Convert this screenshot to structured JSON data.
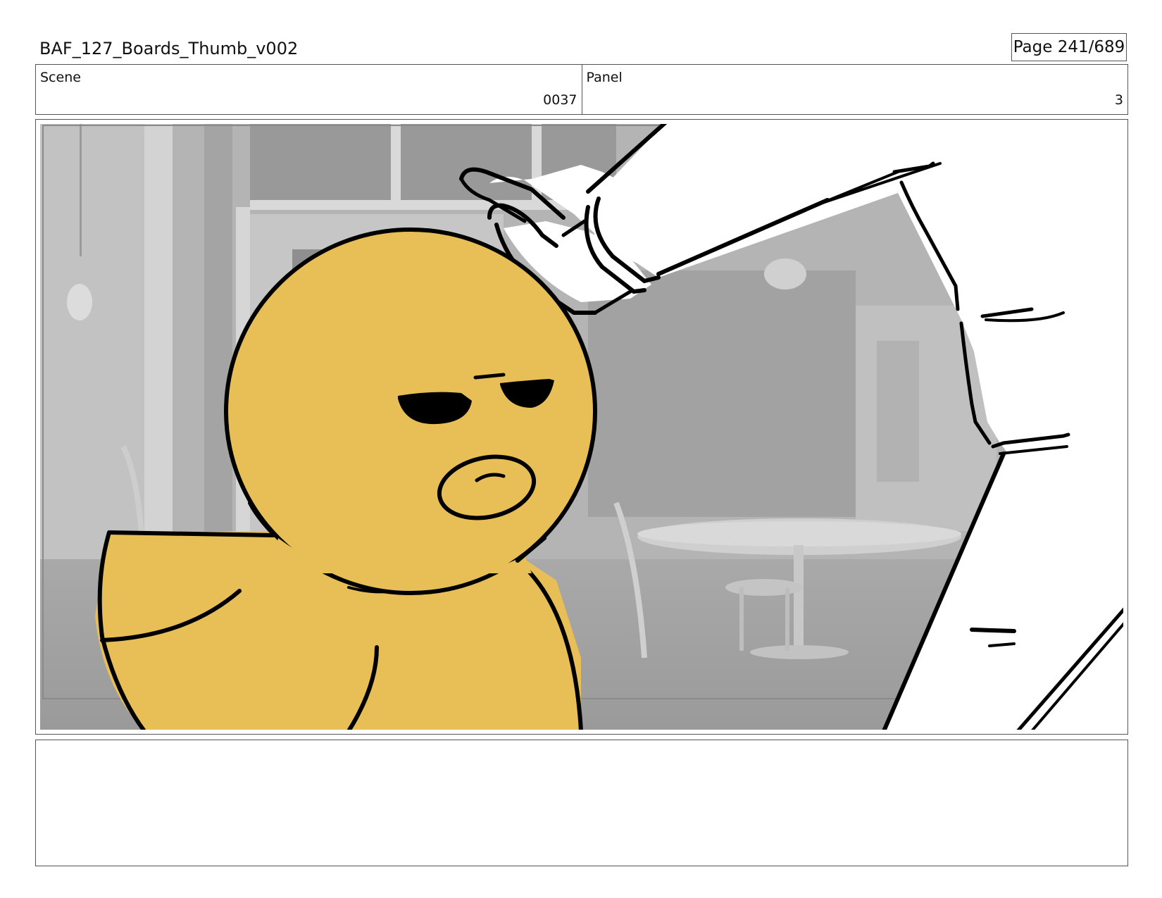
{
  "header": {
    "title": "BAF_127_Boards_Thumb_v002",
    "page_indicator": "Page 241/689"
  },
  "info": {
    "scene_label": "Scene",
    "scene_value": "0037",
    "panel_label": "Panel",
    "panel_value": "3"
  },
  "panel": {
    "colors": {
      "duck_fill": "#E8BF56",
      "outline": "#000000",
      "background_gray": "#A6A6A6"
    }
  },
  "notes": {
    "text": ""
  }
}
